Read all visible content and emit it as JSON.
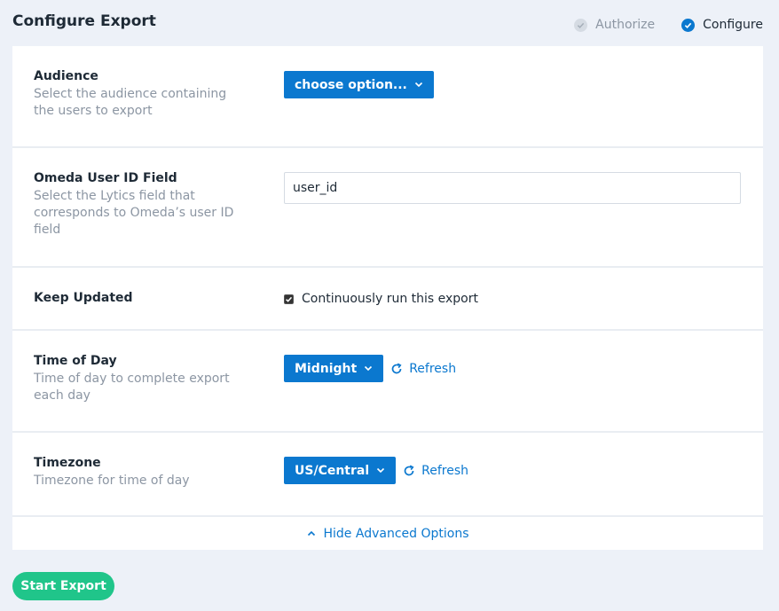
{
  "header": {
    "title": "Configure Export",
    "steps": [
      {
        "label": "Authorize",
        "state": "complete"
      },
      {
        "label": "Configure",
        "state": "current"
      }
    ]
  },
  "fields": {
    "audience": {
      "label": "Audience",
      "description": "Select the audience containing the users to export",
      "select_value": "choose option..."
    },
    "omeda_user_id": {
      "label": "Omeda User ID Field",
      "description": "Select the Lytics field that corresponds to Omeda’s user ID field",
      "input_value": "user_id"
    },
    "keep_updated": {
      "label": "Keep Updated",
      "checkbox_label": "Continuously run this export",
      "checked": true
    },
    "time_of_day": {
      "label": "Time of Day",
      "description": "Time of day to complete export each day",
      "select_value": "Midnight",
      "refresh_label": "Refresh"
    },
    "timezone": {
      "label": "Timezone",
      "description": "Timezone for time of day",
      "select_value": "US/Central",
      "refresh_label": "Refresh"
    }
  },
  "advanced_toggle_label": "Hide Advanced Options",
  "start_button_label": "Start Export",
  "colors": {
    "accent": "#0b78cf",
    "success": "#20c58a",
    "background": "#edf1f8"
  },
  "icons": {
    "step_check": "check-icon",
    "dropdown": "chevron-down-icon",
    "refresh": "refresh-icon",
    "advanced": "chevron-up-icon"
  }
}
